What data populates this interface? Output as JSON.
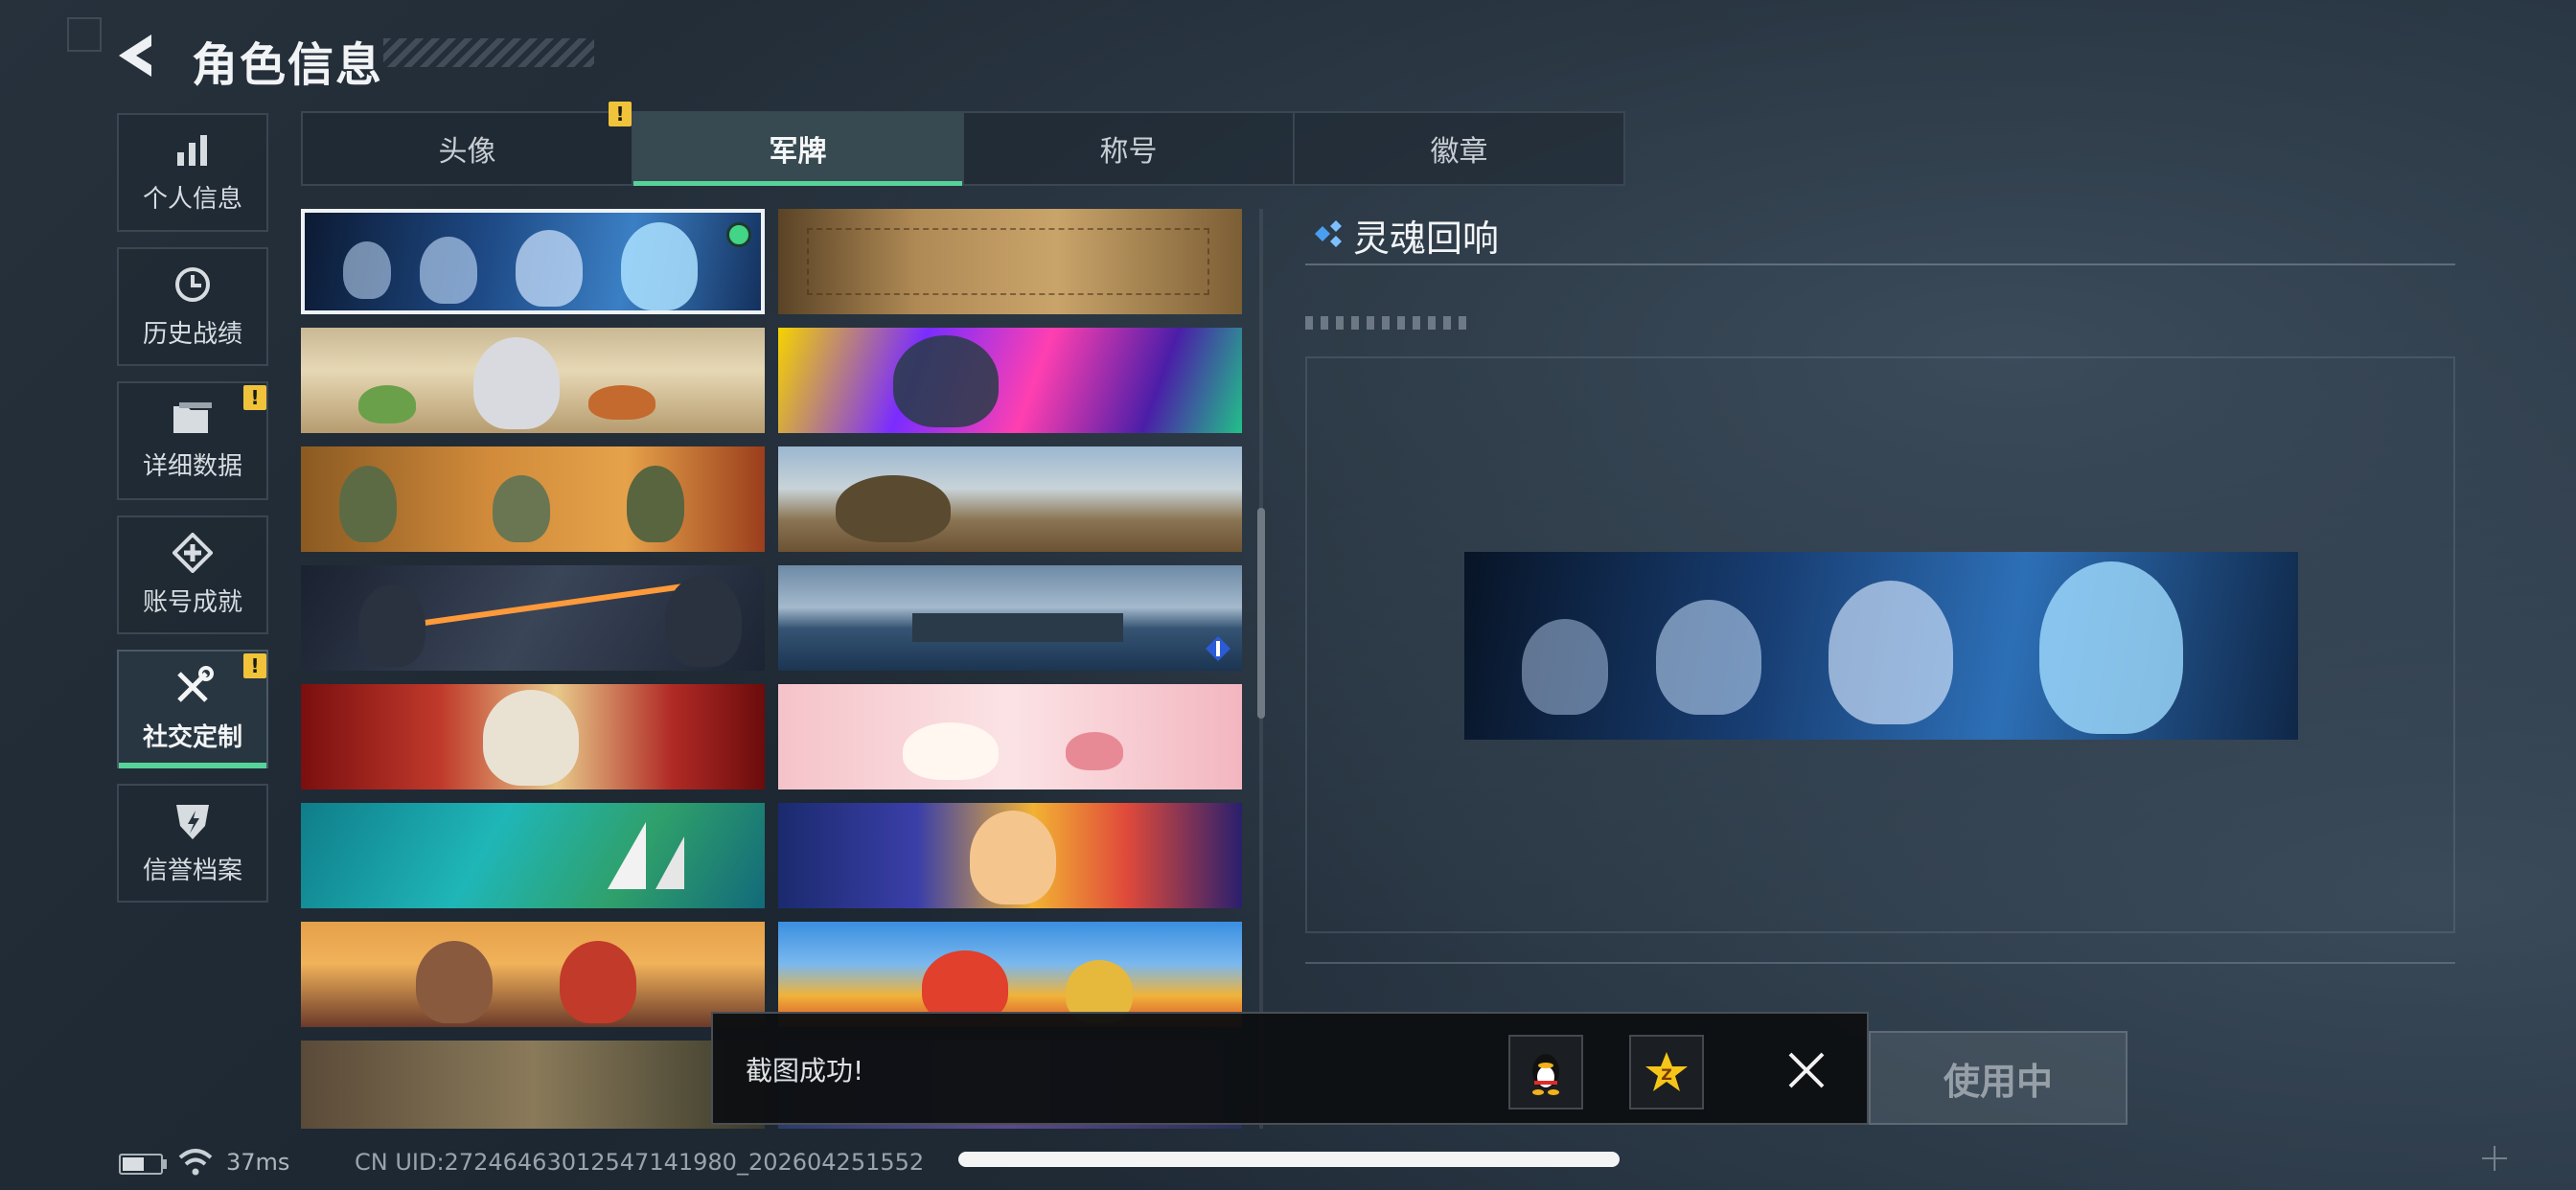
{
  "header": {
    "title": "角色信息"
  },
  "sidebar": {
    "items": [
      {
        "label": "个人信息",
        "icon": "bar-chart-icon"
      },
      {
        "label": "历史战绩",
        "icon": "history-clock-icon"
      },
      {
        "label": "详细数据",
        "icon": "folder-icon"
      },
      {
        "label": "账号成就",
        "icon": "achievement-icon"
      },
      {
        "label": "社交定制",
        "icon": "wrench-screwdriver-icon"
      },
      {
        "label": "信誉档案",
        "icon": "credit-shield-icon"
      }
    ],
    "active_index": 4
  },
  "tabs": {
    "items": [
      {
        "label": "头像"
      },
      {
        "label": "军牌"
      },
      {
        "label": "称号"
      },
      {
        "label": "徽章"
      }
    ],
    "active_index": 1
  },
  "cards": {
    "items": [
      {
        "name": "soul-echo-skeletons",
        "selected": true
      },
      {
        "name": "parchment-blueprint"
      },
      {
        "name": "chibi-kitchen"
      },
      {
        "name": "zoya-neon"
      },
      {
        "name": "squad-feast"
      },
      {
        "name": "desert-sniper"
      },
      {
        "name": "night-operators"
      },
      {
        "name": "harbor-base"
      },
      {
        "name": "red-rose-mech"
      },
      {
        "name": "pink-cake-tea"
      },
      {
        "name": "tropical-sailboats"
      },
      {
        "name": "festival-cartoon"
      },
      {
        "name": "sunset-chibi"
      },
      {
        "name": "fries-carnival"
      },
      {
        "name": "forest-squad"
      },
      {
        "name": "hidden-card"
      }
    ]
  },
  "detail": {
    "title": "灵魂回响",
    "use_button_label": "使用中"
  },
  "toast": {
    "message": "截图成功!",
    "share_icons": [
      "qq-penguin-icon",
      "qzone-star-icon"
    ]
  },
  "status": {
    "ping": "37ms",
    "uid": "CN UID:27246463012547141980_202604251552"
  },
  "colors": {
    "accent": "#57d39a",
    "warning": "#f0c33a",
    "selected_dot": "#42d487"
  }
}
